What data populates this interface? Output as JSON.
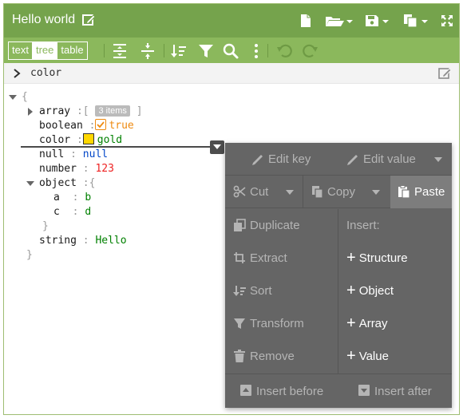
{
  "window": {
    "title": "Hello world"
  },
  "titlebar_icons": [
    "pencil-icon",
    "new-document-icon",
    "open-folder-icon",
    "save-icon",
    "copy-icon",
    "fullscreen-icon"
  ],
  "toolbar": {
    "modes": [
      {
        "label": "text",
        "active": false
      },
      {
        "label": "tree",
        "active": true
      },
      {
        "label": "table",
        "active": false
      }
    ],
    "tools": [
      "expand-all-icon",
      "collapse-all-icon",
      "sort-icon",
      "filter-icon",
      "search-icon",
      "more-icon",
      "undo-icon",
      "redo-icon"
    ]
  },
  "path": {
    "text": "color"
  },
  "tree": {
    "open_brace": "{",
    "close_brace": "}",
    "rows": {
      "array": {
        "key": "array",
        "sep": ":",
        "open": "[",
        "badge": "3 items",
        "close": "]"
      },
      "boolean": {
        "key": "boolean",
        "sep": ":",
        "value": "true"
      },
      "color": {
        "key": "color",
        "sep": ":",
        "value": "gold",
        "swatch": "#ffd700"
      },
      "null": {
        "key": "null",
        "sep": ":",
        "value": "null"
      },
      "number": {
        "key": "number",
        "sep": ":",
        "value": "123"
      },
      "object": {
        "key": "object",
        "sep": ":",
        "open": "{",
        "close": "}"
      },
      "a": {
        "key": "a",
        "sep": ":",
        "value": "b"
      },
      "c": {
        "key": "c",
        "sep": ":",
        "value": "d"
      },
      "string": {
        "key": "string",
        "sep": ":",
        "value": "Hello"
      }
    }
  },
  "context_menu": {
    "edit_key": "Edit key",
    "edit_value": "Edit value",
    "cut": "Cut",
    "copy": "Copy",
    "paste": "Paste",
    "duplicate": "Duplicate",
    "extract": "Extract",
    "sort": "Sort",
    "transform": "Transform",
    "remove": "Remove",
    "insert_heading": "Insert:",
    "insert_structure": "Structure",
    "insert_object": "Object",
    "insert_array": "Array",
    "insert_value": "Value",
    "insert_before": "Insert before",
    "insert_after": "Insert after"
  },
  "colors": {
    "accent": "#75a34c",
    "toolbar": "#8bb85c",
    "menu_bg": "#656565",
    "string": "#008000",
    "number": "#ee2222",
    "null": "#0046c8",
    "boolean": "#ee8a10"
  }
}
